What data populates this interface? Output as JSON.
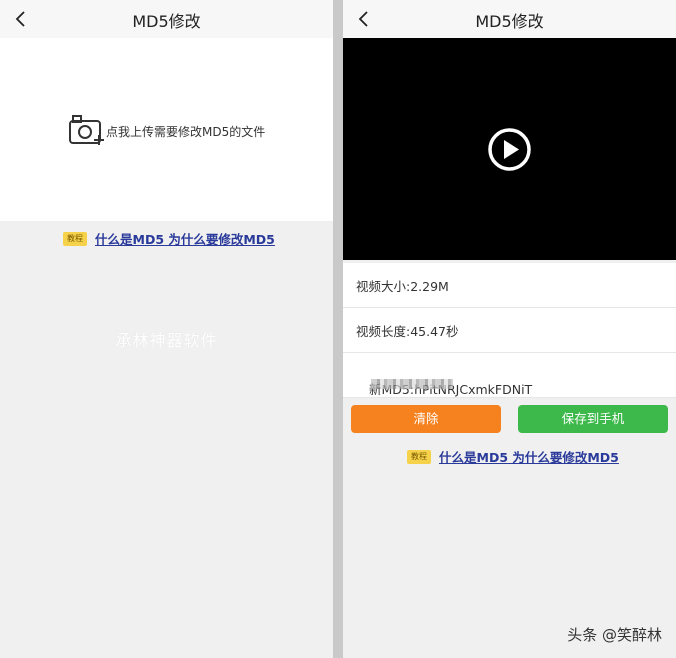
{
  "left": {
    "title": "MD5修改",
    "upload_prompt": "点我上传需要修改MD5的文件",
    "tutorial_tag": "教程",
    "tutorial_link": "什么是MD5 为什么要修改MD5",
    "watermark": "承林神器软件"
  },
  "right": {
    "title": "MD5修改",
    "video_size": "视频大小:2.29M",
    "video_length": "视频长度:45.47秒",
    "new_md5": "新MD5:hPitNRJCxmkFDNiT",
    "clear_label": "清除",
    "save_label": "保存到手机",
    "tutorial_tag": "教程",
    "tutorial_link": "什么是MD5 为什么要修改MD5"
  },
  "credit": "头条 @笑醉林",
  "colors": {
    "orange": "#f5821f",
    "green": "#3cb94a",
    "link": "#2a3a9a",
    "tag": "#f6d24a"
  },
  "icons": {
    "back": "chevron-left-icon",
    "upload": "camera-plus-icon",
    "play": "play-icon"
  }
}
